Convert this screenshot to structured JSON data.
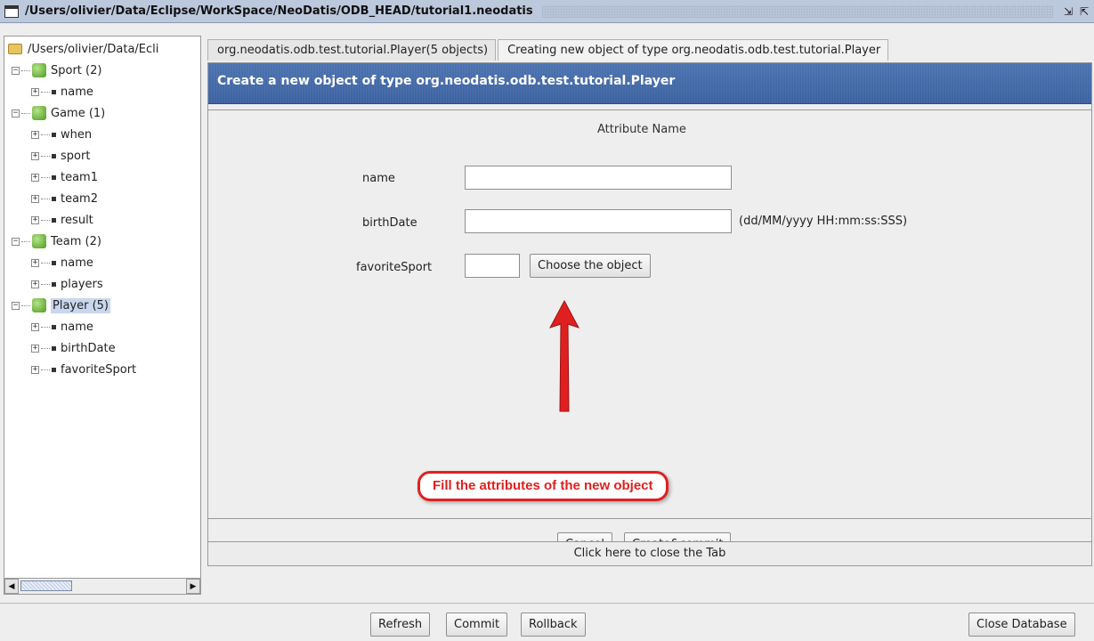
{
  "window": {
    "title": "/Users/olivier/Data/Eclipse/WorkSpace/NeoDatis/ODB_HEAD/tutorial1.neodatis",
    "restore_glyph": "⇲",
    "maximize_glyph": "⇱"
  },
  "tree": {
    "root_label": "/Users/olivier/Data/Ecli",
    "nodes": [
      {
        "label": "Sport (2)",
        "children": [
          "name"
        ]
      },
      {
        "label": "Game (1)",
        "children": [
          "when",
          "sport",
          "team1",
          "team2",
          "result"
        ]
      },
      {
        "label": "Team (2)",
        "children": [
          "name",
          "players"
        ]
      },
      {
        "label": "Player (5)",
        "selected": true,
        "children": [
          "name",
          "birthDate",
          "favoriteSport"
        ]
      }
    ],
    "expand_glyph": "+",
    "collapse_glyph": "−"
  },
  "tabs": [
    {
      "label": "org.neodatis.odb.test.tutorial.Player(5 objects)"
    },
    {
      "label": "Creating new object of type org.neodatis.odb.test.tutorial.Player",
      "active": true
    }
  ],
  "panel": {
    "header": "Create a new object of type org.neodatis.odb.test.tutorial.Player",
    "column_heading": "Attribute Name",
    "fields": {
      "name_label": "name",
      "name_value": "",
      "birthdate_label": "birthDate",
      "birthdate_value": "",
      "birthdate_hint": "(dd/MM/yyyy HH:mm:ss:SSS)",
      "favsport_label": "favoriteSport",
      "favsport_value": "",
      "choose_button": "Choose the object"
    },
    "annotation": "Fill the attributes of the new object",
    "cancel_button": "Cancel",
    "create_button": "Create&commit",
    "close_tab": "Click here to close the Tab"
  },
  "bottom": {
    "refresh": "Refresh",
    "commit": "Commit",
    "rollback": "Rollback",
    "close_db": "Close Database"
  },
  "colors": {
    "header_blue": "#4268a8",
    "annotation_red": "#e02020",
    "selection": "#c9d7ee"
  },
  "icons": {
    "window": "window-icon",
    "folder": "folder-icon",
    "class": "class-cube-icon",
    "attribute": "attribute-square-icon",
    "arrow": "red-arrow-icon"
  }
}
